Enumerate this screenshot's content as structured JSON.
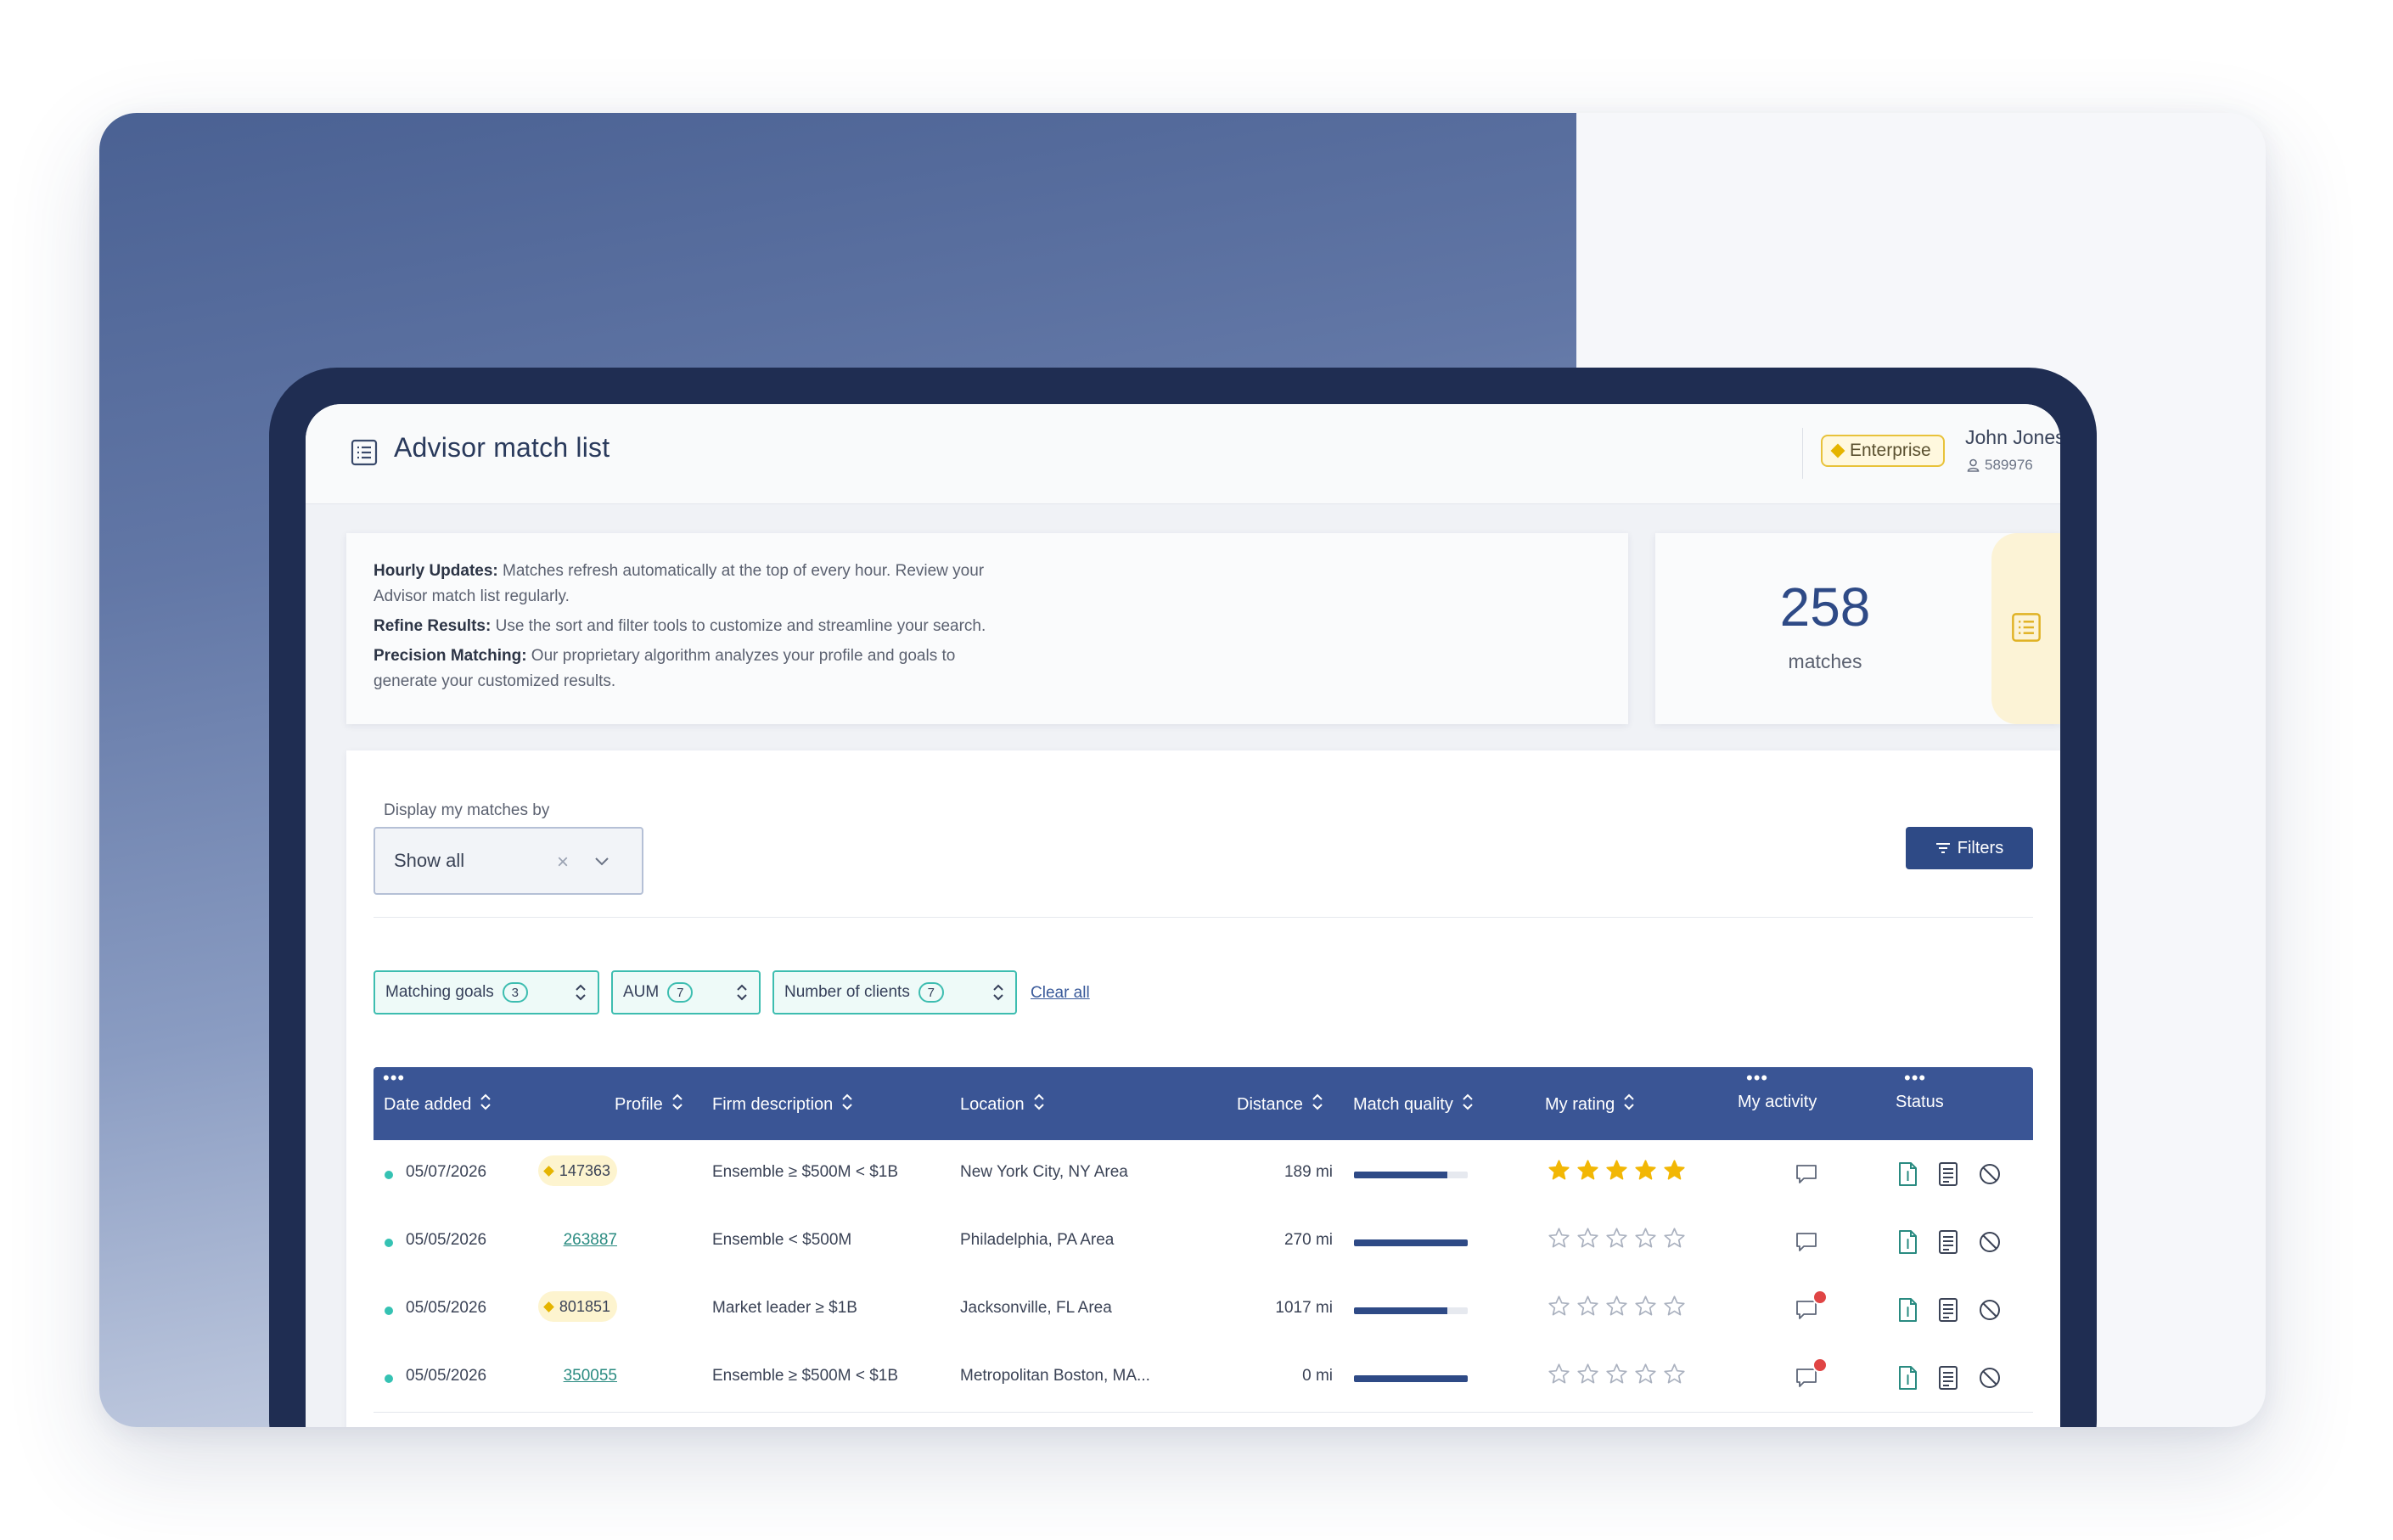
{
  "app": {
    "title": "Advisor match list",
    "plan_badge": "Enterprise",
    "user": {
      "name": "John Jones",
      "id": "589976"
    }
  },
  "info": {
    "items": [
      {
        "heading": "Hourly Updates:",
        "text": " Matches refresh automatically at the top of every hour. Review your Advisor match list regularly."
      },
      {
        "heading": "Refine Results:",
        "text": " Use the sort and filter tools to customize and streamline your search."
      },
      {
        "heading": "Precision Matching:",
        "text": " Our proprietary algorithm analyzes your profile and goals to generate your customized results."
      }
    ]
  },
  "summary": {
    "count": "258",
    "label": "matches"
  },
  "controls": {
    "display_label": "Display my matches by",
    "display_value": "Show all",
    "filters_label": "Filters",
    "clear_all": "Clear all"
  },
  "chips": [
    {
      "label": "Matching goals",
      "count": "3"
    },
    {
      "label": "AUM",
      "count": "7"
    },
    {
      "label": "Number of clients",
      "count": "7"
    }
  ],
  "table": {
    "columns": [
      "Date added",
      "Profile",
      "Firm description",
      "Location",
      "Distance",
      "Match quality",
      "My rating",
      "My activity",
      "Status"
    ],
    "rows": [
      {
        "date": "05/07/2026",
        "profile": "147363",
        "profile_premium": true,
        "firm": "Ensemble ≥ $500M < $1B",
        "location": "New York City, NY Area",
        "distance": "189 mi",
        "quality": 0.82,
        "rating": 5,
        "activity_alert": false
      },
      {
        "date": "05/05/2026",
        "profile": "263887",
        "profile_premium": false,
        "firm": "Ensemble < $500M",
        "location": "Philadelphia, PA Area",
        "distance": "270 mi",
        "quality": 1.0,
        "rating": 0,
        "activity_alert": false
      },
      {
        "date": "05/05/2026",
        "profile": "801851",
        "profile_premium": true,
        "firm": "Market leader ≥ $1B",
        "location": "Jacksonville, FL Area",
        "distance": "1017 mi",
        "quality": 0.82,
        "rating": 0,
        "activity_alert": true
      },
      {
        "date": "05/05/2026",
        "profile": "350055",
        "profile_premium": false,
        "firm": "Ensemble ≥ $500M < $1B",
        "location": "Metropolitan Boston, MA...",
        "distance": "0 mi",
        "quality": 1.0,
        "rating": 0,
        "activity_alert": true
      }
    ]
  },
  "icons": {
    "title": "list-icon",
    "count": "list-icon",
    "filters": "filter-lines-icon",
    "sort": "sort-updown-icon",
    "activity": "chat-bubble-icon",
    "status": [
      "document-icon",
      "notes-icon",
      "block-icon"
    ]
  },
  "colors": {
    "accent": "#2e4a86",
    "table_header": "#3a5595",
    "teal": "#3dbdb0",
    "gold": "#f2b705",
    "alert": "#e04545"
  }
}
